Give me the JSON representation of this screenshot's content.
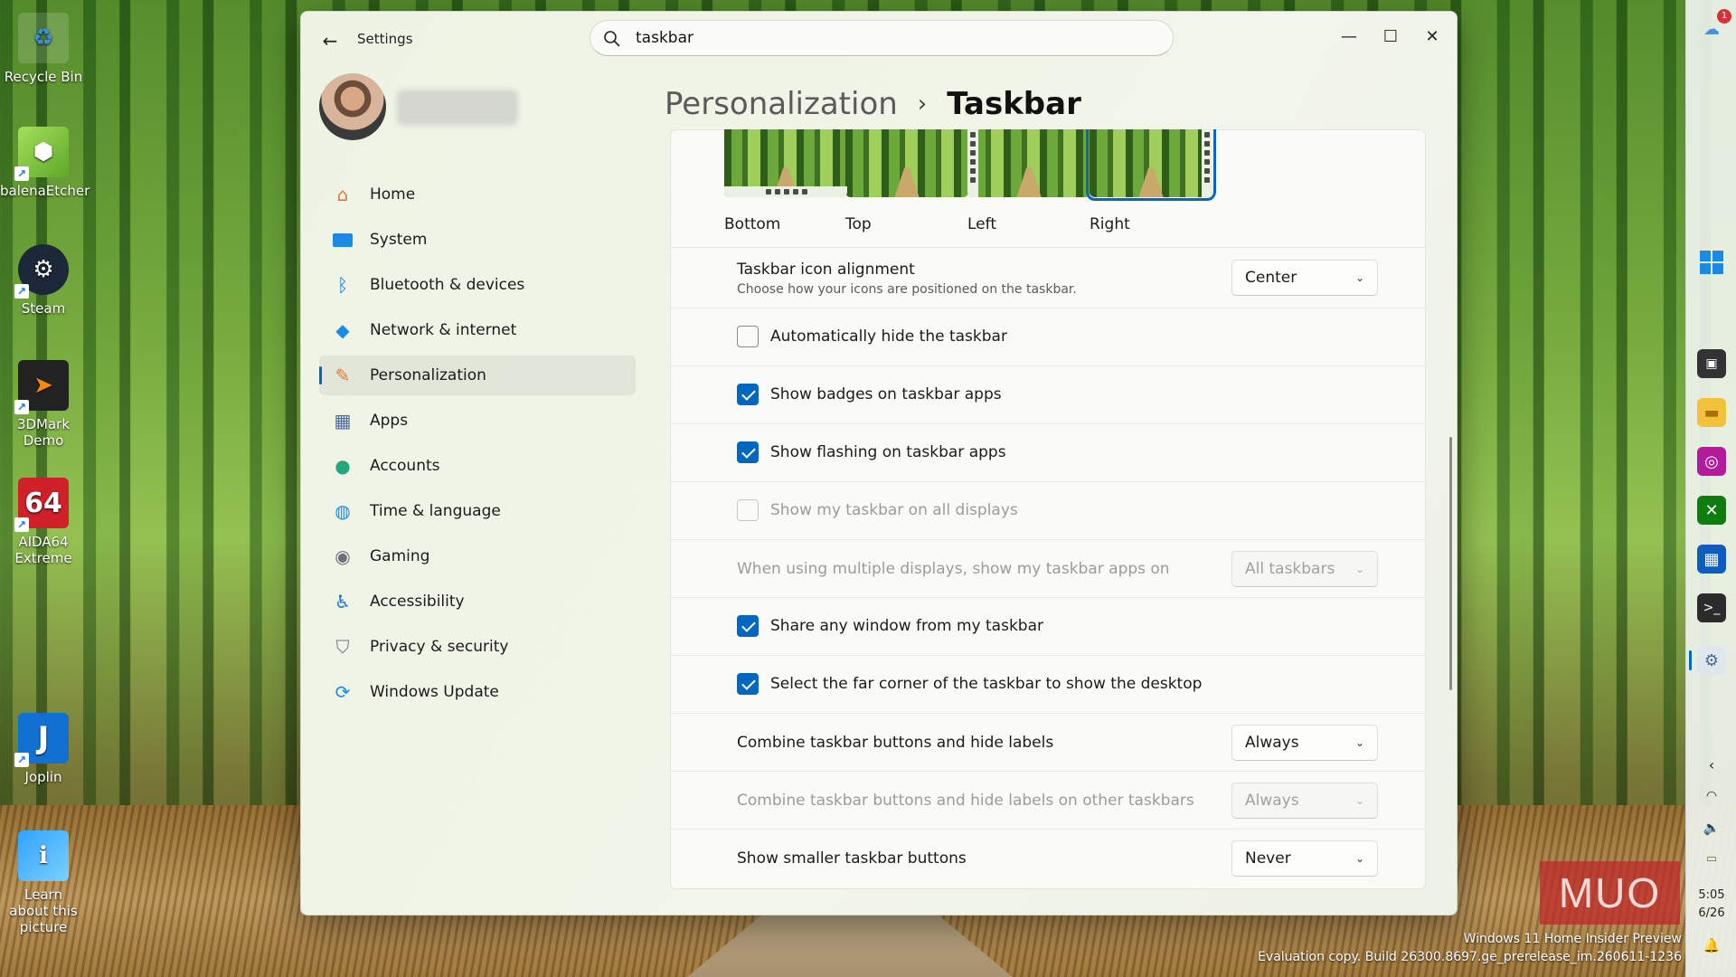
{
  "desktop": {
    "icons": [
      {
        "label": "Recycle Bin"
      },
      {
        "label": "balenaEtcher"
      },
      {
        "label": "Steam"
      },
      {
        "label": "3DMark Demo"
      },
      {
        "label": "AIDA64 Extreme"
      },
      {
        "label": "Joplin"
      },
      {
        "label": "Learn about this picture"
      }
    ],
    "watermark_line1": "Windows 11 Home Insider Preview",
    "watermark_line2": "Evaluation copy. Build 26300.8697.ge_prerelease_im.260611-1236",
    "logo_text": "MUO"
  },
  "window": {
    "app_title": "Settings",
    "search": {
      "value": "taskbar"
    },
    "controls": {
      "minimize": "—",
      "maximize": "☐",
      "close": "✕"
    }
  },
  "nav": {
    "items": [
      {
        "label": "Home",
        "icon": "home-icon"
      },
      {
        "label": "System",
        "icon": "system-icon"
      },
      {
        "label": "Bluetooth & devices",
        "icon": "bluetooth-icon"
      },
      {
        "label": "Network & internet",
        "icon": "wifi-icon"
      },
      {
        "label": "Personalization",
        "icon": "brush-icon"
      },
      {
        "label": "Apps",
        "icon": "apps-icon"
      },
      {
        "label": "Accounts",
        "icon": "accounts-icon"
      },
      {
        "label": "Time & language",
        "icon": "globe-icon"
      },
      {
        "label": "Gaming",
        "icon": "gamepad-icon"
      },
      {
        "label": "Accessibility",
        "icon": "accessibility-icon"
      },
      {
        "label": "Privacy & security",
        "icon": "shield-icon"
      },
      {
        "label": "Windows Update",
        "icon": "update-icon"
      }
    ],
    "active_index": 4
  },
  "breadcrumb": {
    "parent": "Personalization",
    "separator": "›",
    "current": "Taskbar"
  },
  "taskbar_position": {
    "options": [
      "Bottom",
      "Top",
      "Left",
      "Right"
    ],
    "selected": "Right"
  },
  "settings": {
    "icon_alignment": {
      "title": "Taskbar icon alignment",
      "desc": "Choose how your icons are positioned on the taskbar.",
      "value": "Center"
    },
    "auto_hide": {
      "label": "Automatically hide the taskbar",
      "checked": false
    },
    "show_badges": {
      "label": "Show badges on taskbar apps",
      "checked": true
    },
    "show_flashing": {
      "label": "Show flashing on taskbar apps",
      "checked": true
    },
    "all_displays": {
      "label": "Show my taskbar on all displays",
      "checked": false,
      "disabled": true
    },
    "multi_display": {
      "title": "When using multiple displays, show my taskbar apps on",
      "value": "All taskbars",
      "disabled": true
    },
    "share_window": {
      "label": "Share any window from my taskbar",
      "checked": true
    },
    "far_corner": {
      "label": "Select the far corner of the taskbar to show the desktop",
      "checked": true
    },
    "combine": {
      "title": "Combine taskbar buttons and hide labels",
      "value": "Always"
    },
    "combine_other": {
      "title": "Combine taskbar buttons and hide labels on other taskbars",
      "value": "Always",
      "disabled": true
    },
    "smaller_buttons": {
      "title": "Show smaller taskbar buttons",
      "value": "Never"
    }
  },
  "vtaskbar": {
    "notification_count": "1",
    "time": "5:05",
    "date": "6/26"
  },
  "colors": {
    "accent": "#0067c0"
  }
}
